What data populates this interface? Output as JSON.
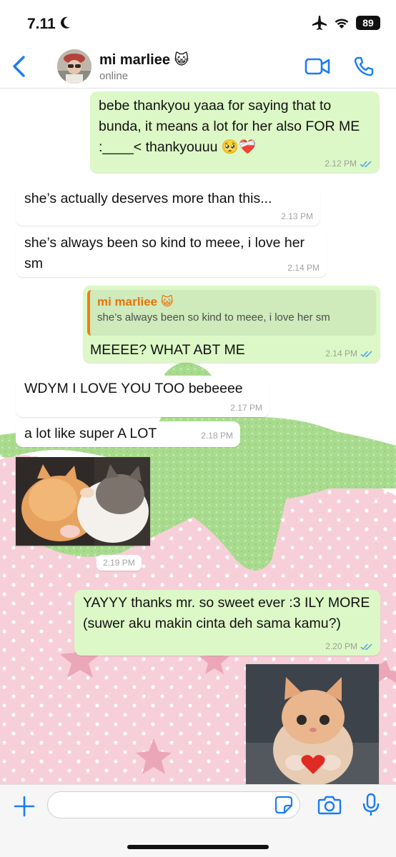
{
  "status_bar": {
    "time": "7.11",
    "battery": "89"
  },
  "header": {
    "contact_name": "mi marliee 😺",
    "contact_status": "online"
  },
  "messages": [
    {
      "id": "m1",
      "direction": "out",
      "text": "bebe thankyou yaaa for saying that to bunda, it means a lot for her also FOR ME :____< thankyouuu 🥺❤️‍🩹",
      "time": "2.12 PM",
      "read": true
    },
    {
      "id": "m2",
      "direction": "in",
      "text": "she’s actually deserves more than this...",
      "time": "2.13 PM"
    },
    {
      "id": "m3",
      "direction": "in",
      "text": "she’s always been so kind to meee, i love her sm",
      "time": "2.14 PM"
    },
    {
      "id": "m4",
      "direction": "out",
      "quote_name": "mi marliee 😺",
      "quote_text": "she’s always been so kind to meee, i love her sm",
      "text": "MEEEE? WHAT ABT ME",
      "time": "2.14 PM",
      "read": true
    },
    {
      "id": "m5",
      "direction": "in",
      "text": "WDYM I LOVE YOU TOO bebeeee",
      "time": "2.17 PM"
    },
    {
      "id": "m6",
      "direction": "in",
      "text": "a lot like super A LOT",
      "time": "2.18 PM"
    },
    {
      "id": "m7",
      "direction": "in",
      "type": "image",
      "description_icon": "kissing-kittens-photo",
      "time": "2.19 PM"
    },
    {
      "id": "m8",
      "direction": "out",
      "text": "YAYYY thanks mr. so sweet ever :3 ILY MORE (suwer aku makin cinta deh sama kamu?)",
      "time": "2.20 PM",
      "read": true
    },
    {
      "id": "m9",
      "direction": "out",
      "type": "image",
      "description_icon": "kitten-holding-heart-photo"
    }
  ],
  "input": {
    "placeholder": "",
    "value": ""
  },
  "colors": {
    "accent": "#1a7cf5",
    "outgoing_bubble": "#dcf8c6",
    "incoming_bubble": "#ffffff",
    "quote_accent": "#f07d12",
    "read_ticks": "#4fa3e8"
  }
}
